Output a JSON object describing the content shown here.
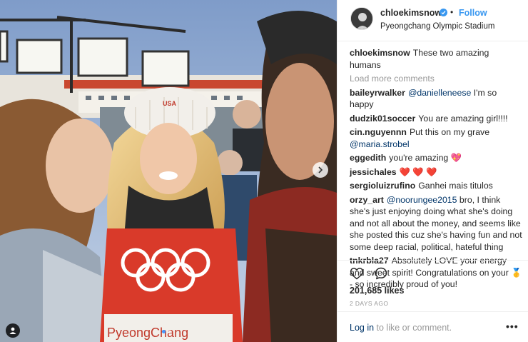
{
  "post": {
    "username": "chloekimsnow",
    "follow_label": "Follow",
    "dot_separator": "•",
    "location": "Pyeongchang Olympic Stadium"
  },
  "caption": {
    "username": "chloekimsnow",
    "text": "These two amazing humans"
  },
  "load_more": "Load more comments",
  "comments": [
    {
      "user": "baileyrwalker",
      "mention": "@danielleneese",
      "text": " I'm so happy"
    },
    {
      "user": "dudzik01soccer",
      "text": "You are amazing girl!!!!"
    },
    {
      "user": "cin.nguyennn",
      "text": "Put this on my grave ",
      "mention": "@maria.strobel"
    },
    {
      "user": "eggedith",
      "text": "you're amazing",
      "emoji": "💖"
    },
    {
      "user": "jessichales",
      "emoji": "❤️ ❤️ ❤️"
    },
    {
      "user": "sergioluizrufino",
      "text": "Ganhei mais titulos"
    },
    {
      "user": "orzy_art",
      "mention": "@noorungee2015",
      "text": " bro, I think she's just enjoying doing what she's doing and not all about the money, and seems like she posted this cuz she's having fun and not some deep racial, political, hateful thing"
    },
    {
      "user": "tnkrbla27",
      "text": "Absolutely LOVE your energy and sweet spirit! Congratulations on your ",
      "emoji": "🥇",
      "text2": "  - so incredibly proud of you!"
    }
  ],
  "stats": {
    "likes": "201,685 likes",
    "date": "2 DAYS AGO"
  },
  "footer": {
    "login_link": "Log in",
    "login_rest": " to like or comment.",
    "more": "•••"
  },
  "photo": {
    "beanie_text": "USA",
    "bib_text": "PyeongChang"
  },
  "colors": {
    "link_blue": "#3897f0",
    "mention_blue": "#003569",
    "muted_gray": "#999999",
    "text": "#262626"
  }
}
